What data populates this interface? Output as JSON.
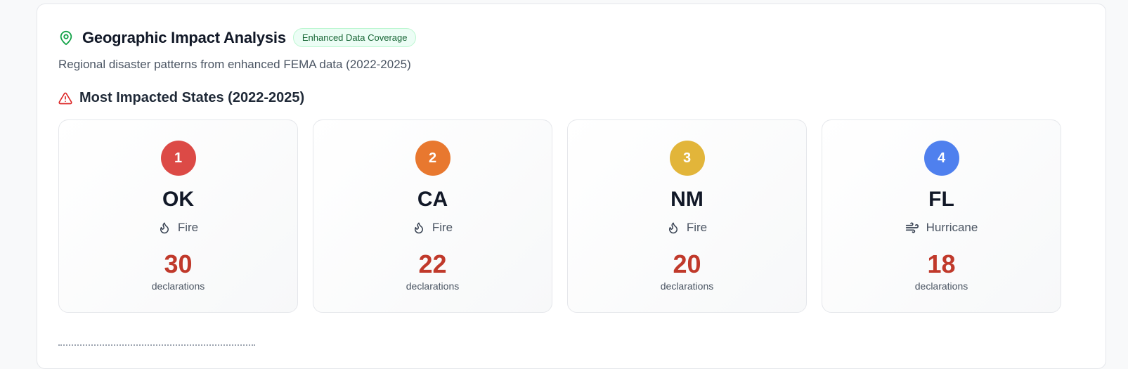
{
  "header": {
    "title": "Geographic Impact Analysis",
    "badge": "Enhanced Data Coverage",
    "subtitle": "Regional disaster patterns from enhanced FEMA data (2022-2025)",
    "icon": "map-pin-icon"
  },
  "section": {
    "title": "Most Impacted States (2022-2025)",
    "icon": "alert-triangle-icon"
  },
  "states": [
    {
      "rank": "1",
      "state": "OK",
      "type": "Fire",
      "type_icon": "flame-icon",
      "count": "30",
      "unit": "declarations",
      "rank_color": "#dc4a46"
    },
    {
      "rank": "2",
      "state": "CA",
      "type": "Fire",
      "type_icon": "flame-icon",
      "count": "22",
      "unit": "declarations",
      "rank_color": "#e8782f"
    },
    {
      "rank": "3",
      "state": "NM",
      "type": "Fire",
      "type_icon": "flame-icon",
      "count": "20",
      "unit": "declarations",
      "rank_color": "#e2b53a"
    },
    {
      "rank": "4",
      "state": "FL",
      "type": "Hurricane",
      "type_icon": "wind-icon",
      "count": "18",
      "unit": "declarations",
      "rank_color": "#4f80ee"
    }
  ],
  "colors": {
    "accent_green": "#16a34a",
    "alert_red": "#dc2626",
    "count_red": "#c0392b"
  }
}
